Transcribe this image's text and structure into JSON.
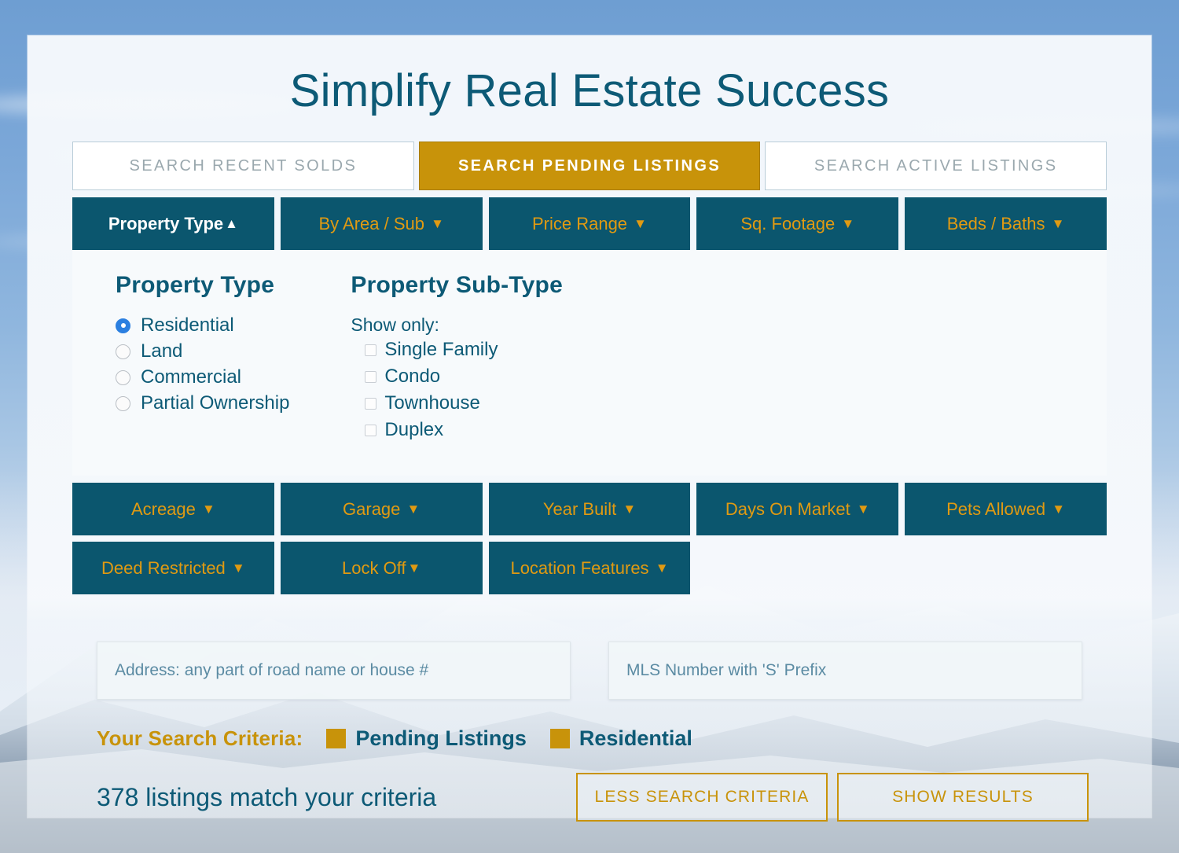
{
  "page": {
    "title": "Simplify Real Estate Success"
  },
  "tabs": [
    {
      "label": "SEARCH RECENT SOLDS",
      "active": false
    },
    {
      "label": "SEARCH PENDING LISTINGS",
      "active": true
    },
    {
      "label": "SEARCH ACTIVE LISTINGS",
      "active": false
    }
  ],
  "filters_row1": [
    {
      "label": "Property Type",
      "caret": "▲",
      "open": true
    },
    {
      "label": "By Area / Sub",
      "caret": "▼",
      "open": false
    },
    {
      "label": "Price Range",
      "caret": "▼",
      "open": false
    },
    {
      "label": "Sq. Footage",
      "caret": "▼",
      "open": false
    },
    {
      "label": "Beds / Baths",
      "caret": "▼",
      "open": false
    }
  ],
  "filters_row2": [
    {
      "label": "Acreage",
      "caret": "▼",
      "open": false
    },
    {
      "label": "Garage",
      "caret": "▼",
      "open": false
    },
    {
      "label": "Year Built",
      "caret": "▼",
      "open": false
    },
    {
      "label": "Days On Market",
      "caret": "▼",
      "open": false
    },
    {
      "label": "Pets Allowed",
      "caret": "▼",
      "open": false
    }
  ],
  "filters_row3": [
    {
      "label": "Deed Restricted",
      "caret": "▼",
      "open": false
    },
    {
      "label": "Lock Off",
      "caret": "▼",
      "open": false
    },
    {
      "label": "Location Features",
      "caret": "▼",
      "open": false
    }
  ],
  "property_type_panel": {
    "heading": "Property Type",
    "options": [
      {
        "label": "Residential",
        "selected": true
      },
      {
        "label": "Land",
        "selected": false
      },
      {
        "label": "Commercial",
        "selected": false
      },
      {
        "label": "Partial Ownership",
        "selected": false
      }
    ]
  },
  "property_subtype_panel": {
    "heading": "Property Sub-Type",
    "sublabel": "Show only:",
    "options": [
      {
        "label": "Single Family",
        "checked": false
      },
      {
        "label": "Condo",
        "checked": false
      },
      {
        "label": "Townhouse",
        "checked": false
      },
      {
        "label": "Duplex",
        "checked": false
      }
    ]
  },
  "inputs": {
    "address": {
      "value": "",
      "placeholder": "Address: any part of road name or house #"
    },
    "mls": {
      "value": "",
      "placeholder": "MLS Number with 'S' Prefix"
    }
  },
  "criteria": {
    "label": "Your Search Criteria:",
    "chips": [
      "Pending Listings",
      "Residential"
    ]
  },
  "results": {
    "match_text": "378 listings match your criteria",
    "count": 378
  },
  "actions": [
    {
      "label": "LESS SEARCH CRITERIA"
    },
    {
      "label": "SHOW RESULTS"
    }
  ],
  "colors": {
    "teal": "#0b566e",
    "gold": "#c8930a",
    "orange_text": "#e09a12",
    "title_teal": "#0d5a76",
    "radio_blue": "#2b7fe0"
  }
}
